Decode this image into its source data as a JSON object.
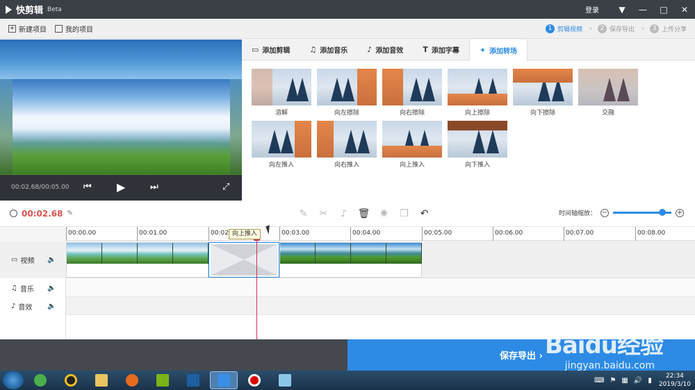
{
  "app": {
    "name": "快剪辑",
    "badge": "Beta",
    "login": "登录"
  },
  "window": {
    "menu_icon": "▼",
    "minimize_icon": "—",
    "maximize_icon": "□",
    "close_icon": "✕"
  },
  "toolbar": {
    "new_project": "新建项目",
    "my_projects": "我的项目"
  },
  "steps": [
    {
      "num": "1",
      "label": "剪辑视频",
      "active": true
    },
    {
      "num": "2",
      "label": "保存导出",
      "active": false
    },
    {
      "num": "3",
      "label": "上传分享",
      "active": false
    }
  ],
  "preview": {
    "timecode": "00:02.68/00:05.00"
  },
  "tabs": [
    {
      "label": "添加剪辑",
      "icon": "▭"
    },
    {
      "label": "添加音乐",
      "icon": "♫"
    },
    {
      "label": "添加音效",
      "icon": "♪"
    },
    {
      "label": "添加字幕",
      "icon": "T"
    },
    {
      "label": "添加转场",
      "icon": "✦"
    }
  ],
  "transitions": [
    {
      "label": "溶解"
    },
    {
      "label": "向左擦除"
    },
    {
      "label": "向右擦除"
    },
    {
      "label": "向上擦除"
    },
    {
      "label": "向下擦除"
    },
    {
      "label": "交融"
    },
    {
      "label": "向左推入"
    },
    {
      "label": "向右推入"
    },
    {
      "label": "向上推入"
    },
    {
      "label": "向下推入"
    }
  ],
  "timeline": {
    "current_time": "00:02.68",
    "zoom_label": "时间轴缩放：",
    "zoom_level": 0.85,
    "ticks": [
      "00:00.00",
      "00:01.00",
      "00:02.00",
      "00:03.00",
      "00:04.00",
      "00:05.00",
      "00:06.00",
      "00:07.00",
      "00:08.00"
    ],
    "tooltip": "向上推入"
  },
  "tracks": {
    "video": "视频",
    "music": "音乐",
    "sfx": "音效"
  },
  "export": {
    "label": "保存导出 ›"
  },
  "watermark": {
    "brand": "Baidu经验",
    "url": "jingyan.baidu.com"
  },
  "tray": {
    "time": "22:34",
    "date": "2019/3/10"
  },
  "colors": {
    "accent": "#2d8be6",
    "playhead": "#d62d5a",
    "time": "#d9534f"
  }
}
